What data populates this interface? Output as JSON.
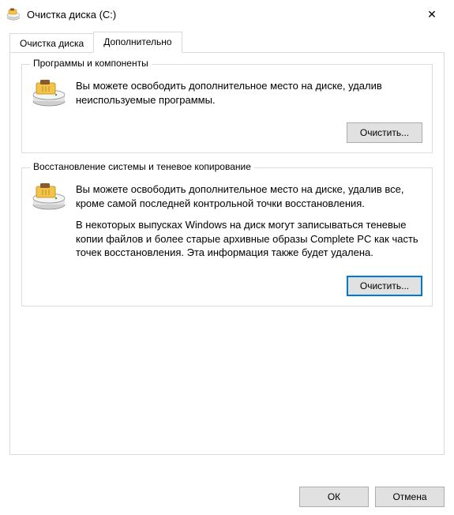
{
  "window": {
    "title": "Очистка диска  (C:)",
    "close_glyph": "✕"
  },
  "tabs": {
    "cleanup": "Очистка диска",
    "more": "Дополнительно"
  },
  "groups": {
    "programs": {
      "legend": "Программы и компоненты",
      "text": "Вы можете освободить дополнительное место на диске, удалив неиспользуемые программы.",
      "button": "Очистить..."
    },
    "restore": {
      "legend": "Восстановление системы и теневое копирование",
      "text1": "Вы можете освободить дополнительное место на диске, удалив все, кроме самой последней контрольной точки восстановления.",
      "text2": "В некоторых выпусках Windows на диск могут записываться теневые копии файлов и более старые архивные образы Complete PC как часть точек восстановления. Эта информация также будет удалена.",
      "button": "Очистить..."
    }
  },
  "footer": {
    "ok": "ОК",
    "cancel": "Отмена"
  },
  "icons": {
    "disk_cleanup": "disk-cleanup-icon"
  }
}
